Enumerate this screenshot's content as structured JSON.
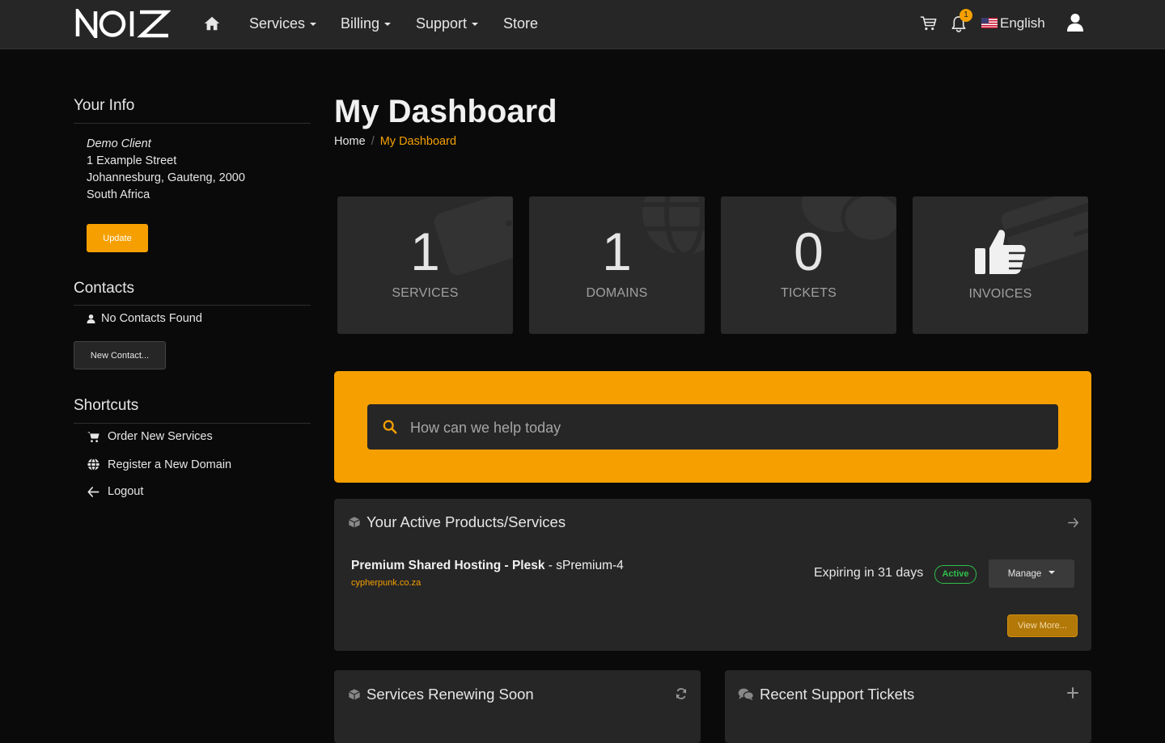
{
  "nav": {
    "brand": "NOIZ",
    "items": [
      "Services",
      "Billing",
      "Support",
      "Store"
    ],
    "notification_count": "1",
    "language": "English"
  },
  "sidebar": {
    "your_info": {
      "title": "Your Info",
      "name": "Demo Client",
      "street": "1 Example Street",
      "city_line": "Johannesburg, Gauteng, 2000",
      "country": "South Africa",
      "update_label": "Update"
    },
    "contacts": {
      "title": "Contacts",
      "empty_text": "No Contacts Found",
      "new_contact_label": "New Contact..."
    },
    "shortcuts": {
      "title": "Shortcuts",
      "items": [
        "Order New Services",
        "Register a New Domain",
        "Logout"
      ]
    }
  },
  "main": {
    "title": "My Dashboard",
    "breadcrumb": {
      "home": "Home",
      "current": "My Dashboard"
    },
    "tiles": [
      {
        "value": "1",
        "label": "SERVICES"
      },
      {
        "value": "1",
        "label": "DOMAINS"
      },
      {
        "value": "0",
        "label": "TICKETS"
      },
      {
        "value": "",
        "label": "INVOICES"
      }
    ],
    "help_search": {
      "placeholder": "How can we help today"
    },
    "active_products": {
      "title": "Your Active Products/Services",
      "service_name": "Premium Shared Hosting - Plesk",
      "service_plan": "sPremium-4",
      "domain": "cypherpunk.co.za",
      "expiry": "Expiring in 31 days",
      "status": "Active",
      "manage_label": "Manage",
      "view_more_label": "View More..."
    },
    "renewing_soon": {
      "title": "Services Renewing Soon"
    },
    "support_tickets": {
      "title": "Recent Support Tickets"
    }
  },
  "colors": {
    "accent": "#f5a000",
    "background": "#0a0a0a",
    "card": "#262626",
    "status_active": "#2fbf4a"
  }
}
